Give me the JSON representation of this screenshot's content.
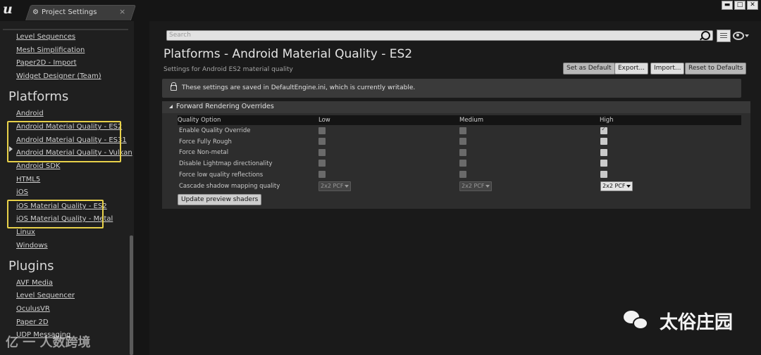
{
  "app": {
    "logo": "u",
    "tab_title": "Project Settings",
    "tab_icon": "⚙",
    "tab_close": "×",
    "window_controls": {
      "minimize": "▬",
      "maximize": "□",
      "close": "✕"
    }
  },
  "sidebar": {
    "items_top": [
      "Level Sequences",
      "Mesh Simplification",
      "Paper2D - Import",
      "Widget Designer (Team)"
    ],
    "platforms_heading": "Platforms",
    "platforms_items": [
      "Android",
      "Android Material Quality - ES2",
      "Android Material Quality - ES31",
      "Android Material Quality - Vulkan",
      "Android SDK",
      "HTML5",
      "iOS",
      "iOS Material Quality - ES2",
      "iOS Material Quality - Metal",
      "Linux",
      "Windows"
    ],
    "plugins_heading": "Plugins",
    "plugins_items": [
      "AVF Media",
      "Level Sequencer",
      "OculusVR",
      "Paper 2D",
      "UDP Messaging"
    ],
    "highlight_color": "#e8d14a"
  },
  "search": {
    "placeholder": "Search"
  },
  "header": {
    "title": "Platforms - Android Material Quality - ES2",
    "subtitle": "Settings for Android ES2 material quality",
    "buttons": {
      "set_default": "Set as Default",
      "export": "Export...",
      "import": "Import...",
      "reset": "Reset to Defaults"
    }
  },
  "notice": {
    "text": "These settings are saved in DefaultEngine.ini, which is currently writable."
  },
  "section": {
    "title": "Forward Rendering Overrides",
    "columns": [
      "Quality Option",
      "Low",
      "Medium",
      "High"
    ],
    "rows": [
      "Enable Quality Override",
      "Force Fully Rough",
      "Force Non-metal",
      "Disable Lightmap directionality",
      "Force low quality reflections",
      "Cascade shadow mapping quality"
    ],
    "dropdown_value": "2x2 PCF",
    "high_override_checked": true,
    "update_button": "Update preview shaders"
  },
  "watermarks": {
    "left": "亿 一 人数跨境",
    "right": "太俗庄园"
  }
}
